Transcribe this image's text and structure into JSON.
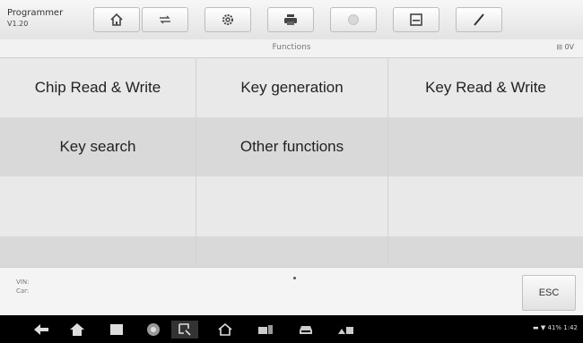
{
  "app": {
    "name": "Programmer",
    "version": "V1.20"
  },
  "toolbar": {
    "buttons": [
      {
        "icon": "home-icon"
      },
      {
        "icon": "vehicle-swap-icon"
      },
      {
        "icon": "settings-gear-icon"
      },
      {
        "icon": "print-icon"
      },
      {
        "icon": "help-icon"
      },
      {
        "icon": "save-icon"
      },
      {
        "icon": "pen-icon"
      }
    ]
  },
  "subbar": {
    "title": "Functions",
    "battery_label": "0V",
    "battery_icon": "battery-icon"
  },
  "functions": {
    "rows": [
      [
        "Chip Read & Write",
        "Key generation",
        "Key Read & Write"
      ],
      [
        "Key search",
        "Other functions",
        ""
      ],
      [
        "",
        "",
        ""
      ],
      [
        "",
        "",
        ""
      ]
    ]
  },
  "footer": {
    "vin_label": "VIN:",
    "car_label": "Car:",
    "esc_label": "ESC"
  },
  "navbar": {
    "icons": [
      "back-icon",
      "home-icon",
      "recent-apps-icon",
      "browser-icon",
      "screenshot-icon",
      "maxisys-home-icon",
      "vci-icon",
      "car-icon",
      "shop-icon"
    ],
    "status_text": "41% 1:42"
  },
  "colors": {
    "row_light": "#e9e9e9",
    "row_dark": "#d9d9d9",
    "navbar": "#000000"
  }
}
